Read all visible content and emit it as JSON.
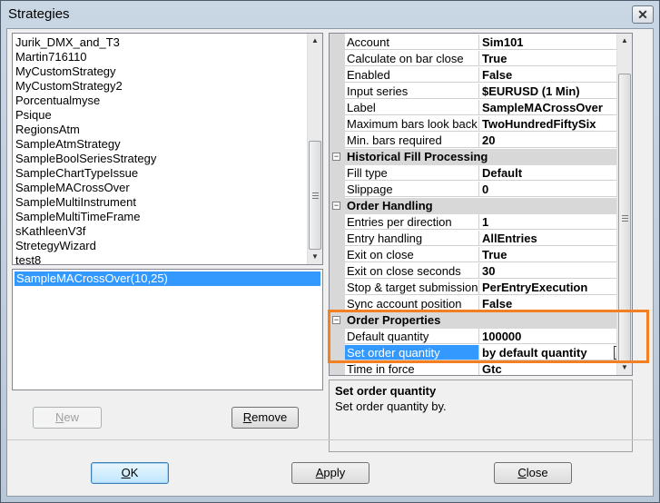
{
  "window": {
    "title": "Strategies",
    "close_glyph": "✕"
  },
  "strategy_list": {
    "items": [
      "Jurik_DMX_and_T3",
      "Martin716110",
      "MyCustomStrategy",
      "MyCustomStrategy2",
      "Porcentualmyse",
      "Psique",
      "RegionsAtm",
      "SampleAtmStrategy",
      "SampleBoolSeriesStrategy",
      "SampleChartTypeIssue",
      "SampleMACrossOver",
      "SampleMultiInstrument",
      "SampleMultiTimeFrame",
      "sKathleenV3f",
      "StretegyWizard",
      "test8"
    ]
  },
  "instance_list": {
    "items": [
      "SampleMACrossOver(10,25)"
    ]
  },
  "buttons": {
    "new": {
      "pre": "",
      "accel": "N",
      "post": "ew"
    },
    "remove": {
      "pre": "",
      "accel": "R",
      "post": "emove"
    },
    "ok": {
      "pre": "",
      "accel": "O",
      "post": "K"
    },
    "apply": {
      "pre": "",
      "accel": "A",
      "post": "pply"
    },
    "close": {
      "pre": "",
      "accel": "C",
      "post": "lose"
    }
  },
  "property_grid": {
    "rows": [
      {
        "name": "Account",
        "value": "Sim101"
      },
      {
        "name": "Calculate on bar close",
        "value": "True"
      },
      {
        "name": "Enabled",
        "value": "False"
      },
      {
        "name": "Input series",
        "value": "$EURUSD (1 Min)"
      },
      {
        "name": "Label",
        "value": "SampleMACrossOver"
      },
      {
        "name": "Maximum bars look back",
        "value": "TwoHundredFiftySix"
      },
      {
        "name": "Min. bars required",
        "value": "20"
      }
    ],
    "cat_historical": "Historical Fill Processing",
    "historical_rows": [
      {
        "name": "Fill type",
        "value": "Default"
      },
      {
        "name": "Slippage",
        "value": "0"
      }
    ],
    "cat_order_handling": "Order Handling",
    "order_handling_rows": [
      {
        "name": "Entries per direction",
        "value": "1"
      },
      {
        "name": "Entry handling",
        "value": "AllEntries"
      },
      {
        "name": "Exit on close",
        "value": "True"
      },
      {
        "name": "Exit on close seconds",
        "value": "30"
      },
      {
        "name": "Stop & target submission",
        "value": "PerEntryExecution"
      },
      {
        "name": "Sync account position",
        "value": "False"
      }
    ],
    "cat_order_properties": "Order Properties",
    "order_properties_rows": [
      {
        "name": "Default quantity",
        "value": "100000"
      },
      {
        "name": "Set order quantity",
        "value": "by default quantity"
      }
    ],
    "partial_row": {
      "name": "Time in force",
      "value": "Gtc"
    },
    "toggle_glyph": "−"
  },
  "description": {
    "title": "Set order quantity",
    "text": "Set order quantity by."
  },
  "colors": {
    "highlight": "#f37f20",
    "selection": "#3399ff"
  }
}
